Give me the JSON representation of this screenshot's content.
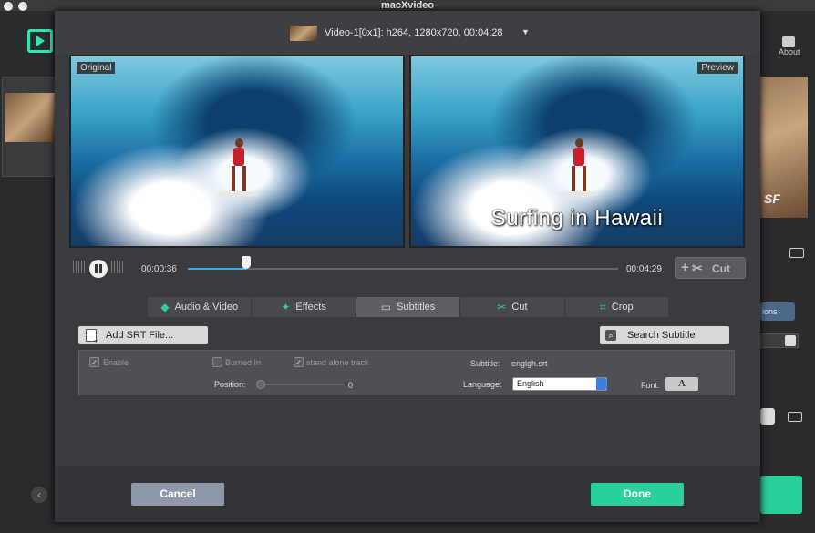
{
  "app": {
    "title": "macXvideo",
    "about_label": "About",
    "right_button_fragment": "ions"
  },
  "video": {
    "info": "Video-1[0x1]: h264, 1280x720, 00:04:28"
  },
  "preview": {
    "original_tag": "Original",
    "preview_tag": "Preview",
    "subtitle_overlay": "Surfing in Hawaii"
  },
  "playback": {
    "current_time": "00:00:36",
    "total_time": "00:04:29",
    "progress": 0.135,
    "cut_label": "Cut"
  },
  "tabs": [
    {
      "label": "Audio & Video",
      "icon": "audio-video-icon"
    },
    {
      "label": "Effects",
      "icon": "effects-wand-icon"
    },
    {
      "label": "Subtitles",
      "icon": "subtitles-icon",
      "active": true
    },
    {
      "label": "Cut",
      "icon": "scissors-icon"
    },
    {
      "label": "Crop",
      "icon": "crop-icon"
    }
  ],
  "subtitles": {
    "add_srt_label": "Add SRT File...",
    "search_subtitle_label": "Search Subtitle",
    "enable_label": "Enable",
    "burned_in_label": "Burned In",
    "standalone_label": "stand alone track",
    "position_label": "Position:",
    "position_value": "0",
    "subtitle_label": "Subtitle:",
    "subtitle_file": "englgh.srt",
    "language_label": "Language:",
    "language_value": "English",
    "font_label": "Font:",
    "font_button": "A",
    "enable_checked": true,
    "burned_in_checked": false,
    "standalone_checked": true
  },
  "footer": {
    "cancel_label": "Cancel",
    "done_label": "Done"
  },
  "colors": {
    "accent": "#2bcf9c",
    "progress": "#3fa8e8"
  }
}
